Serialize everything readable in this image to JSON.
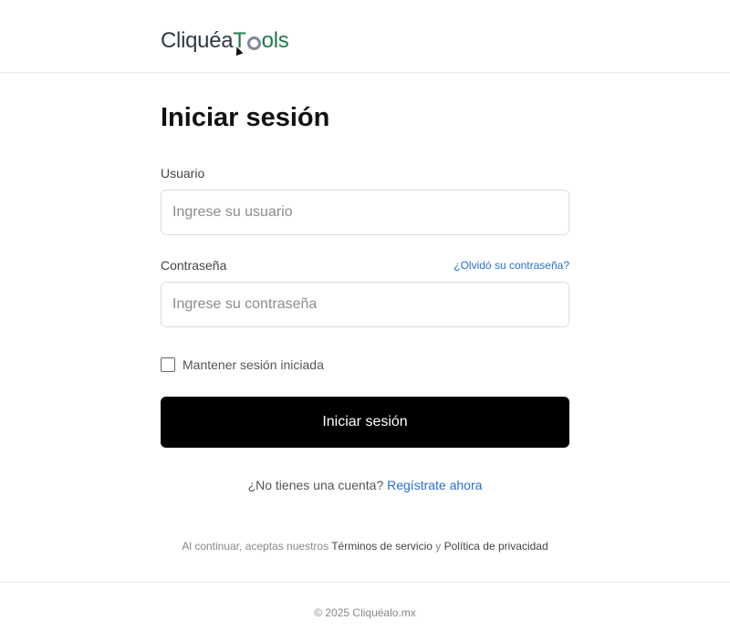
{
  "header": {
    "logo_part1": "Cliquéa",
    "logo_part2": "T",
    "logo_part3": "ols"
  },
  "login": {
    "title": "Iniciar sesión",
    "username_label": "Usuario",
    "username_placeholder": "Ingrese su usuario",
    "username_value": "",
    "password_label": "Contraseña",
    "password_placeholder": "Ingrese su contraseña",
    "password_value": "",
    "forgot_link": "¿Olvidó su contraseña?",
    "remember_label": "Mantener sesión iniciada",
    "remember_checked": false,
    "submit_label": "Iniciar sesión",
    "signup_prompt": "¿No tienes una cuenta?",
    "signup_link": "Regístrate ahora",
    "terms_prefix": "Al continuar, aceptas nuestros",
    "terms_link": "Términos de servicio",
    "terms_and": "y",
    "privacy_link": "Política de privacidad"
  },
  "footer": {
    "copyright": "© 2025 Cliquéalo.mx"
  },
  "colors": {
    "accent": "#2a6fc9",
    "button": "#000000",
    "logo_green": "#1f7a4a"
  },
  "icons": [
    "gear-icon",
    "cursor-icon"
  ]
}
